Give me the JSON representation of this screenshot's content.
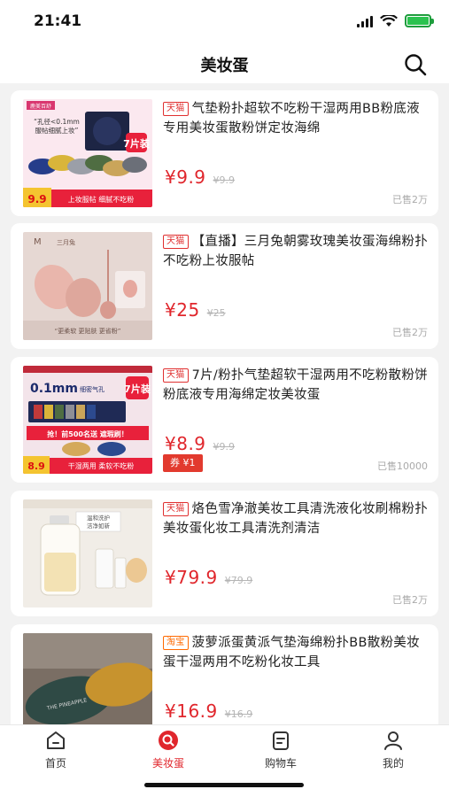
{
  "status": {
    "time": "21:41"
  },
  "header": {
    "title": "美妆蛋"
  },
  "products": [
    {
      "shop": "天猫",
      "title": "气垫粉扑超软不吃粉干湿两用BB粉底液专用美妆蛋散粉饼定妆海绵",
      "price": "¥9.9",
      "original_price": "¥9.9",
      "sold": "已售2万",
      "image_text": [
        "鹿美百舒",
        "“孔径<0.1mm",
        "服帖细腻上妆”",
        "7片装",
        "9.9",
        "上妆服帖 细腻不吃粉"
      ]
    },
    {
      "shop": "天猫",
      "title": "【直播】三月兔朝雾玫瑰美妆蛋海绵粉扑不吃粉上妆服帖",
      "price": "¥25",
      "original_price": "¥25",
      "sold": "已售2万",
      "image_text": [
        "M",
        "三月兔",
        "“更柔软 更贴肤 更省粉”"
      ]
    },
    {
      "shop": "天猫",
      "title": "7片/粉扑气垫超软干湿两用不吃粉散粉饼粉底液专用海绵定妆美妆蛋",
      "price": "¥8.9",
      "original_price": "¥9.9",
      "sold": "已售10000",
      "coupon": "券 ¥1",
      "image_text": [
        "0.1mm",
        "细密气孔",
        "7片装",
        "抢！前500名送 遮瑕刷！",
        "8.9",
        "干湿两用 柔软不吃粉"
      ]
    },
    {
      "shop": "天猫",
      "title": "烙色雪净澈美妆工具清洗液化妆刷棉粉扑美妆蛋化妆工具清洗剂清洁",
      "price": "¥79.9",
      "original_price": "¥79.9",
      "sold": "已售2万",
      "image_text": [
        "温和洗护",
        "洁净如新"
      ]
    },
    {
      "shop": "淘宝",
      "title": "菠萝派蛋黄派气垫海绵粉扑BB散粉美妆蛋干湿两用不吃粉化妆工具",
      "price": "¥16.9",
      "original_price": "¥16.9",
      "sold": "",
      "image_text": [
        "THE PINEAPPLE"
      ]
    }
  ],
  "tabs": [
    {
      "label": "首页",
      "icon": "home-icon"
    },
    {
      "label": "美妆蛋",
      "icon": "search-circle-icon",
      "active": true
    },
    {
      "label": "购物车",
      "icon": "cart-list-icon"
    },
    {
      "label": "我的",
      "icon": "user-icon"
    }
  ],
  "colors": {
    "accent": "#e0262c",
    "tmall_tag": "#e03030",
    "taobao_tag": "#ff6a00",
    "coupon_bg": "#e23a2e"
  }
}
